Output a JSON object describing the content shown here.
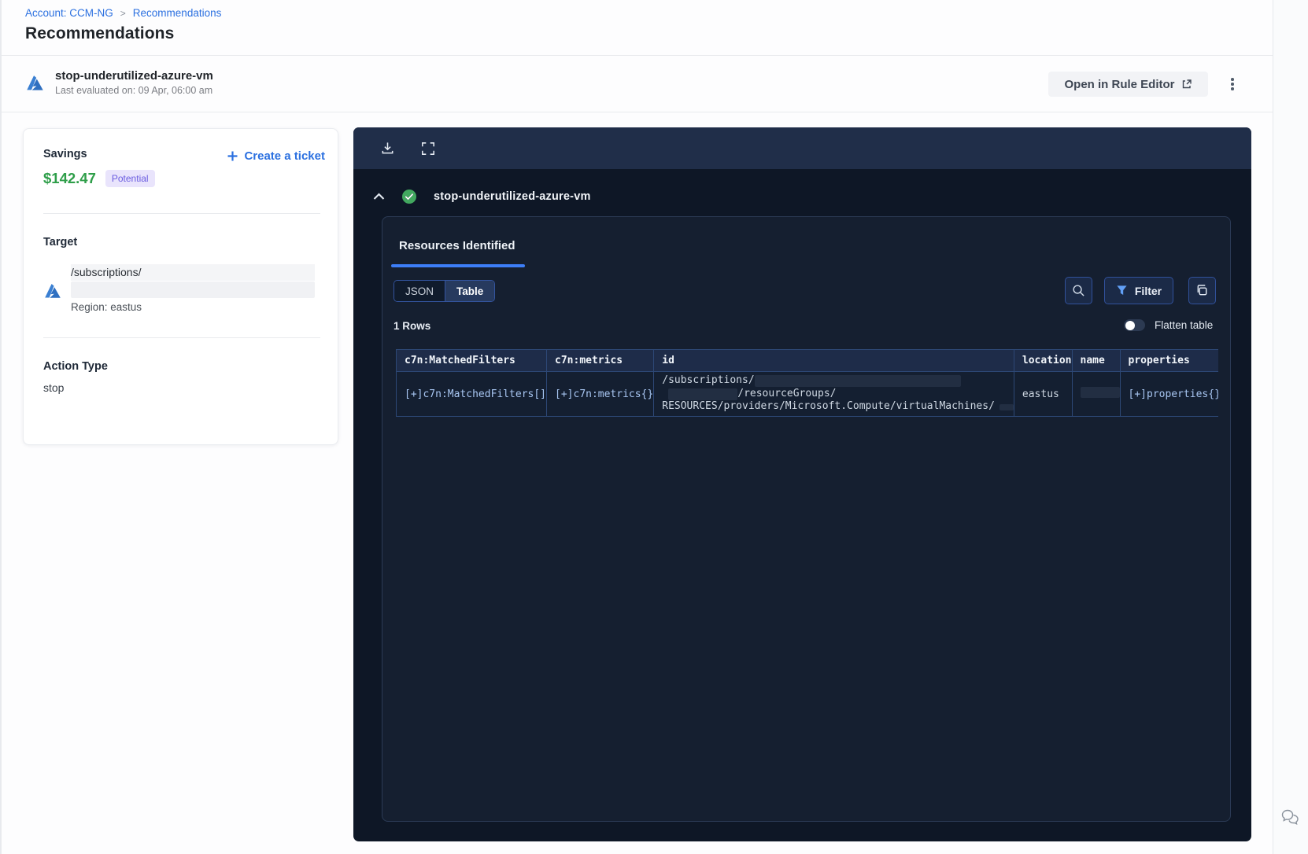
{
  "breadcrumb": {
    "account": "Account: CCM-NG",
    "separator": ">",
    "current": "Recommendations"
  },
  "page": {
    "title": "Recommendations"
  },
  "rule_header": {
    "name": "stop-underutilized-azure-vm",
    "last_evaluated": "Last evaluated on: 09 Apr, 06:00 am",
    "open_in_rule_editor": "Open in Rule Editor"
  },
  "savings_card": {
    "savings_label": "Savings",
    "amount": "$142.47",
    "badge": "Potential",
    "create_ticket": "Create a ticket",
    "target_label": "Target",
    "target_path": "/subscriptions/",
    "region": "Region: eastus",
    "action_type_label": "Action Type",
    "action_type_value": "stop"
  },
  "results_panel": {
    "rule_name": "stop-underutilized-azure-vm",
    "tab": "Resources Identified",
    "view_toggle": {
      "json": "JSON",
      "table": "Table",
      "active": "Table"
    },
    "filter_label": "Filter",
    "rows_count": "1 Rows",
    "flatten_label": "Flatten table",
    "table": {
      "columns": [
        "c7n:MatchedFilters",
        "c7n:metrics",
        "id",
        "location",
        "name",
        "properties"
      ],
      "row": {
        "matched_filters": "[+]c7n:MatchedFilters[]",
        "metrics": "[+]c7n:metrics{}",
        "id_line1": "/subscriptions/",
        "id_line2": "/resourceGroups/",
        "id_line3": "RESOURCES/providers/Microsoft.Compute/virtualMachines/",
        "location": "eastus",
        "name": "",
        "properties": "[+]properties{}"
      }
    }
  },
  "colors": {
    "link_blue": "#2b70e0",
    "savings_green": "#2e9e49",
    "badge_bg": "#e9e4fc",
    "badge_text": "#6a5ce0",
    "panel_bg": "#0e1726",
    "panel_topbar": "#202e49",
    "tab_underline": "#3d7ef7",
    "table_border": "#2d4876",
    "success_green": "#42a85f"
  }
}
